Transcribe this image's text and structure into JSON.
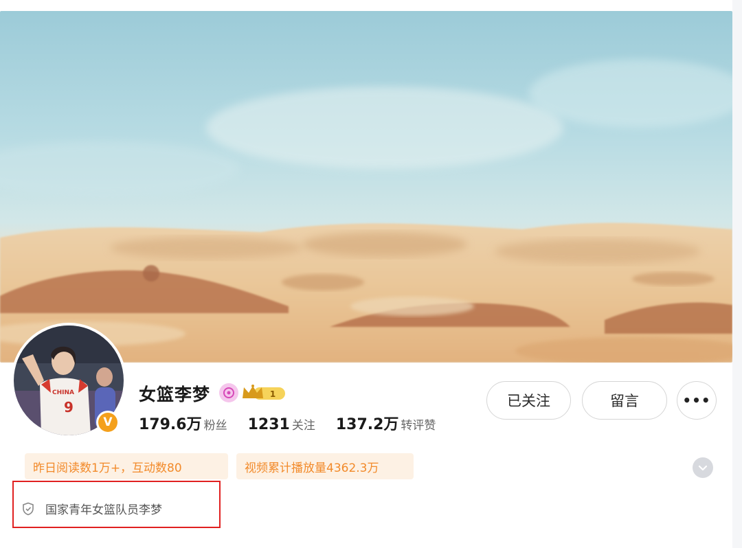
{
  "profile": {
    "name": "女篮李梦",
    "vip_level": "1",
    "verified_mark": "V",
    "jersey_number": "9",
    "jersey_text": "CHINA",
    "bio": "国家青年女篮队员李梦"
  },
  "stats": {
    "fans_value": "179.6万",
    "fans_label": "粉丝",
    "following_value": "1231",
    "following_label": "关注",
    "interactions_value": "137.2万",
    "interactions_label": "转评赞"
  },
  "actions": {
    "follow_label": "已关注",
    "message_label": "留言",
    "more_label": "•••"
  },
  "tags": {
    "reads": "昨日阅读数1万+，互动数80",
    "video_plays": "视频累计播放量4362.3万"
  },
  "icons": {
    "verify": "verified-v-icon",
    "special": "pink-sparkle-icon",
    "vip": "crown-vip-icon",
    "expand": "chevron-down-icon",
    "bio": "shield-icon",
    "more": "more-dots-icon"
  },
  "colors": {
    "accent_orange": "#f28a2a",
    "tag_bg": "#fdf1e4",
    "verify_gold": "#f4a01c",
    "highlight_red": "#e02020"
  }
}
